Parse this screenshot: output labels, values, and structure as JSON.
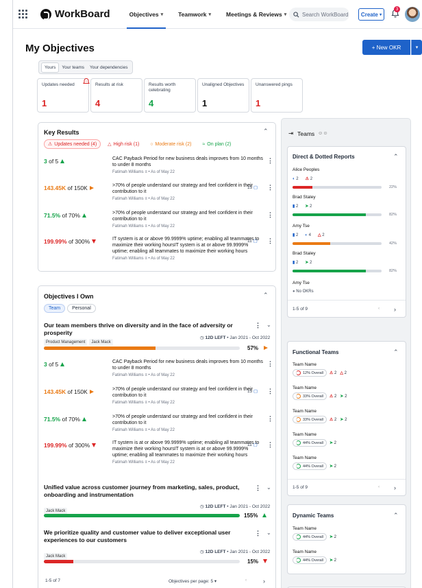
{
  "app": {
    "brand": "WorkBoard"
  },
  "nav": [
    {
      "label": "Objectives"
    },
    {
      "label": "Teamwork"
    },
    {
      "label": "Meetings & Reviews"
    }
  ],
  "search": {
    "placeholder": "Search WorkBoard"
  },
  "create": {
    "label": "Create"
  },
  "notifications": {
    "count": "3"
  },
  "page": {
    "title": "My Objectives",
    "new_okr": "+ New OKR"
  },
  "view_tabs": [
    "Yours",
    "Your teams",
    "Your dependencies"
  ],
  "stats": [
    {
      "label": "Updates needed",
      "value": "1"
    },
    {
      "label": "Results at risk",
      "value": "4"
    },
    {
      "label": "Results worth celebrating",
      "value": "4"
    },
    {
      "label": "Unaligned Objectives",
      "value": "1"
    },
    {
      "label": "Unanswered pings",
      "value": "1"
    }
  ],
  "key_results": {
    "title": "Key Results",
    "filters": [
      "Updates needed (4)",
      "High risk (1)",
      "Moderate risk (2)",
      "On plan (2)"
    ],
    "items": [
      {
        "value": "3",
        "of": "of 5",
        "desc": "CAC Payback Period for new business deals improves from 10 months to under 8 months",
        "owner": "Fatimah Williams",
        "asof": "• As of May 22",
        "trend": "up",
        "count": ""
      },
      {
        "value": "143.45K",
        "of": "of 150K",
        "desc": ">70% of people understand our strategy and feel confident in their contribution to it",
        "owner": "Fatimah Williams",
        "asof": "• As of May 22",
        "trend": "right",
        "count": "15"
      },
      {
        "value": "71.5%",
        "of": "of 70%",
        "desc": ">70% of people understand our strategy and feel confident in their contribution to it",
        "owner": "Fatimah Williams",
        "asof": "• As of May 22",
        "trend": "up",
        "count": ""
      },
      {
        "value": "199.99%",
        "of": "of 300%",
        "desc": "IT system is at or above 99.9999% uptime; enabling all teammates to maximize their working hoursIT system is at or above 99.9999% uptime; enabling all teammates to maximize their working hours",
        "owner": "Fatimah Williams",
        "asof": "• As of May 22",
        "trend": "down",
        "count": "11"
      }
    ]
  },
  "objectives": {
    "title": "Objectives I Own",
    "toggle": [
      "Team",
      "Personal"
    ],
    "items": [
      {
        "title": "Our team members thrive on diversity and in the face of adversity or prosperity",
        "chips": [
          "Product Management",
          "Jack Mack"
        ],
        "left": "12D LEFT",
        "range": "• Jan 2021 - Oct 2022",
        "pct": "57%",
        "progress": 57,
        "color": "#ea7a14",
        "trend": "right"
      },
      {
        "title": "Unified value across customer journey from marketing, sales, product, onboarding and instrumentation",
        "chips": [
          "Jack Mack"
        ],
        "left": "12D LEFT",
        "range": "• Jan 2021 - Oct 2022",
        "pct": "155%",
        "progress": 100,
        "color": "#16a34a",
        "trend": "up"
      },
      {
        "title": "We prioritize quality and customer value to deliver exceptional user experiences to our customers",
        "chips": [
          "Jack Mack"
        ],
        "left": "12D LEFT",
        "range": "• Jan 2021 - Oct 2022",
        "pct": "15%",
        "progress": 15,
        "color": "#dc2626",
        "trend": "down"
      }
    ],
    "pager": "1-5 of 7",
    "per_page": "Objectives per page:",
    "per_page_value": "5"
  },
  "teams_panel": {
    "title": "Teams",
    "direct": {
      "title": "Direct & Dotted Reports",
      "people": [
        {
          "name": "Alice Peoples",
          "a": "2",
          "b": "2",
          "c": "",
          "pct": "22%",
          "progress": 22,
          "color": "#dc2626"
        },
        {
          "name": "Brad Staley",
          "a": "2",
          "b": "2",
          "c": "",
          "pct": "82%",
          "progress": 82,
          "color": "#16a34a"
        },
        {
          "name": "Amy Tse",
          "a": "2",
          "b": "4",
          "c": "2",
          "pct": "42%",
          "progress": 42,
          "color": "#ea7a14"
        },
        {
          "name": "Brad Staley",
          "a": "2",
          "b": "2",
          "c": "",
          "pct": "82%",
          "progress": 82,
          "color": "#16a34a"
        },
        {
          "name": "Amy Tse",
          "note": "No OKRs"
        }
      ],
      "pager": "1-5 of 9"
    },
    "functional": {
      "title": "Functional Teams",
      "teams": [
        {
          "name": "Team Name",
          "overall": "12% Overall",
          "a": "2",
          "b": "2",
          "ring": "#dc2626"
        },
        {
          "name": "Team Name",
          "overall": "33% Overall",
          "a": "2",
          "b": "2",
          "ring": "#ea7a14"
        },
        {
          "name": "Team Name",
          "overall": "33% Overall",
          "a": "2",
          "b": "2",
          "ring": "#ea7a14"
        },
        {
          "name": "Team Name",
          "overall": "44% Overall",
          "a": "2",
          "ring": "#16a34a"
        },
        {
          "name": "Team Name",
          "overall": "44% Overall",
          "a": "2",
          "ring": "#16a34a"
        }
      ],
      "pager": "1-5 of 9"
    },
    "dynamic": {
      "title": "Dynamic Teams",
      "teams": [
        {
          "name": "Team Name",
          "overall": "44% Overall",
          "a": "2"
        },
        {
          "name": "Team Name",
          "overall": "44% Overall",
          "a": "2"
        }
      ]
    }
  },
  "colors": {
    "accent": "#1e62c9",
    "red": "#dc2626",
    "orange": "#ea7a14",
    "green": "#16a34a"
  }
}
